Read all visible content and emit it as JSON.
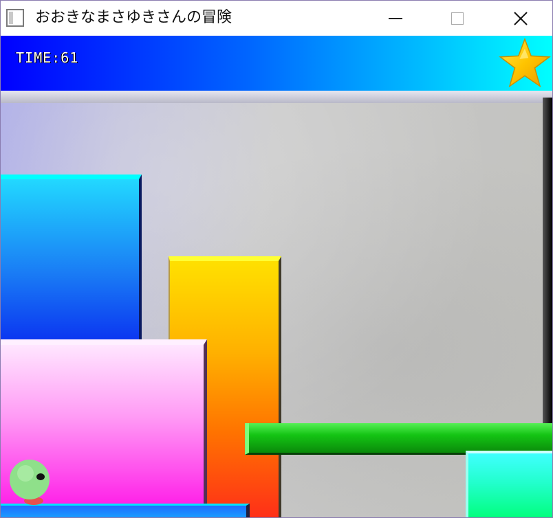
{
  "window": {
    "title": "おおきなまさゆきさんの冒険",
    "app_icon": "app-icon",
    "controls": {
      "minimize": "minimize-icon",
      "maximize": "maximize-icon",
      "close": "close-icon",
      "close_glyph": "✕"
    }
  },
  "hud": {
    "time_text": "TIME:61",
    "star": "star-icon",
    "colors": {
      "gradient_start": "#0000ff",
      "gradient_end": "#00ffff",
      "star": "#ffd400"
    }
  },
  "scene": {
    "blocks": [
      "cyan",
      "yellow",
      "pink",
      "green",
      "teal",
      "blue"
    ],
    "player": "player-character"
  }
}
